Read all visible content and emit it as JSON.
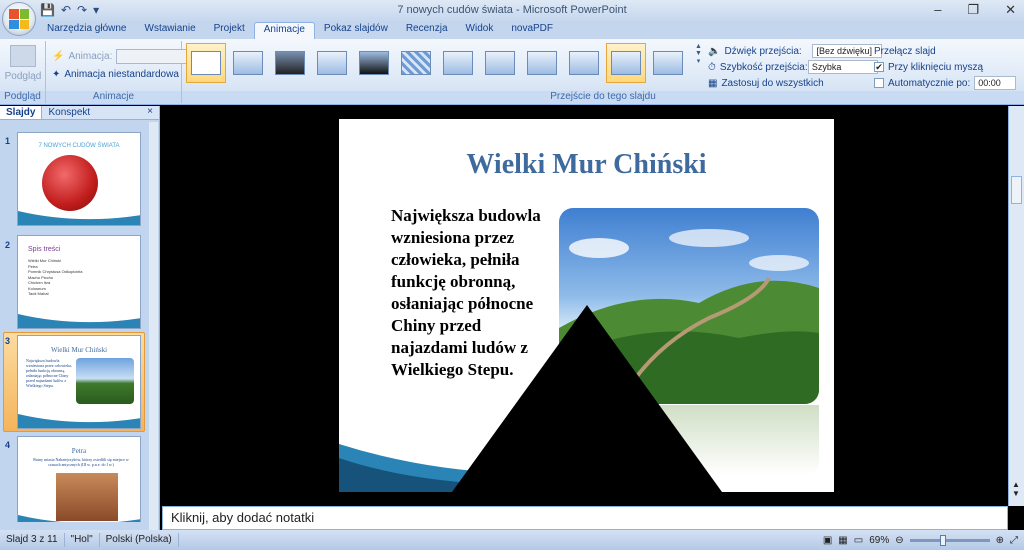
{
  "window": {
    "title": "7 nowych cudów świata - Microsoft PowerPoint",
    "minimize": "–",
    "restore": "❐",
    "close": "✕"
  },
  "qat": [
    "💾",
    "↶",
    "↷",
    "▾"
  ],
  "tabs": [
    "Narzędzia główne",
    "Wstawianie",
    "Projekt",
    "Animacje",
    "Pokaz slajdów",
    "Recenzja",
    "Widok",
    "novaPDF"
  ],
  "active_tab": "Animacje",
  "ribbon": {
    "preview": {
      "button": "Podgląd",
      "group": "Podgląd"
    },
    "animations": {
      "animation_label": "Animacja:",
      "custom_label": "Animacja niestandardowa",
      "group": "Animacje"
    },
    "transition_group": "Przejście do tego slajdu",
    "sound_label": "Dźwięk przejścia:",
    "sound_value": "[Bez dźwięku]",
    "speed_label": "Szybkość przejścia:",
    "speed_value": "Szybka",
    "apply_all": "Zastosuj do wszystkich",
    "advance_label": "Przełącz slajd",
    "on_click_label": "Przy kliknięciu myszą",
    "on_click_checked": true,
    "auto_label": "Automatycznie po:",
    "auto_checked": false,
    "auto_time": "00:00"
  },
  "left_pane": {
    "tabs": [
      "Slajdy",
      "Konspekt"
    ],
    "close": "×",
    "slides": [
      {
        "num": "1",
        "title": "7 NOWYCH CUDÓW ŚWIATA"
      },
      {
        "num": "2",
        "title": "Spis treści",
        "items": [
          "Wielki Mur Chiński",
          "Petra",
          "Pomnik Chrystusa Odkupiciela",
          "Machu Picchu",
          "Chichen Itza",
          "Koloseum",
          "Tadż Mahal"
        ]
      },
      {
        "num": "3",
        "title": "Wielki Mur Chiński",
        "body": "Największa budowla wzniesiona przez człowieka, pełniła funkcję obronną, osłaniając północne Chiny przed najazdami ludów z Wielkiego Stepu."
      },
      {
        "num": "4",
        "title": "Petra",
        "body": "Ruiny miasta Nabatejczyków, którzy osiedlili się miejsce w czasach antycznych (III w. p.n.e. do I w.)"
      }
    ]
  },
  "slide": {
    "title": "Wielki Mur Chiński",
    "body": "Największa budowla wzniesiona przez człowieka, pełniła funkcję obronną, osłaniając północne Chiny przed najazdami ludów z Wielkiego Stepu."
  },
  "notes_placeholder": "Kliknij, aby dodać notatki",
  "status": {
    "slide": "Slajd 3 z 11",
    "theme": "\"Hol\"",
    "language": "Polski (Polska)",
    "zoom": "69%"
  },
  "colors": {
    "ribbon": "#dbe7f6",
    "accent": "#3f6a9d",
    "selection": "#f5b45b"
  }
}
